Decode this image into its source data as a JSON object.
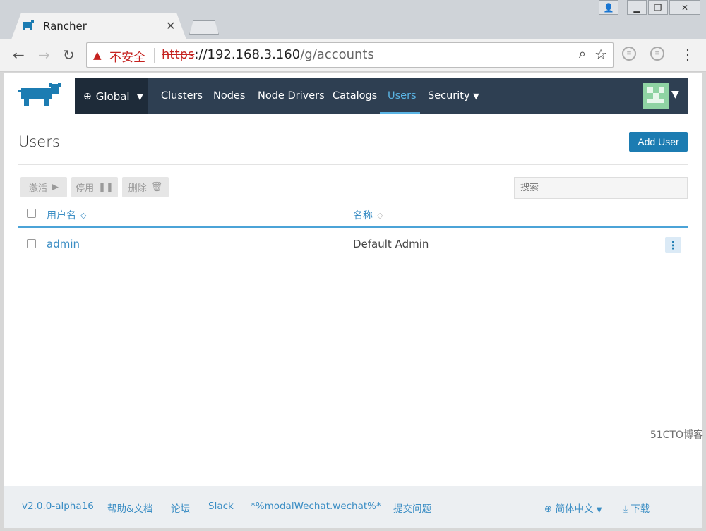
{
  "browser": {
    "tab_title": "Rancher",
    "insecure_label": "不安全",
    "url_scheme": "https",
    "url_host": "://192.168.3.160",
    "url_path": "/g/accounts"
  },
  "nav": {
    "global": "Global",
    "items": [
      "Clusters",
      "Nodes",
      "Node Drivers",
      "Catalogs",
      "Users",
      "Security"
    ]
  },
  "page": {
    "title": "Users",
    "add_button": "Add User"
  },
  "bulk_actions": {
    "activate": "激活",
    "deactivate": "停用",
    "delete": "删除"
  },
  "search": {
    "placeholder": "搜索"
  },
  "table": {
    "columns": [
      "用户名",
      "名称"
    ],
    "rows": [
      {
        "username": "admin",
        "name": "Default Admin"
      }
    ]
  },
  "footer": {
    "version": "v2.0.0-alpha16",
    "help": "帮助&文档",
    "forum": "论坛",
    "slack": "Slack",
    "wechat": "*%modalWechat.wechat%*",
    "issue": "提交问题",
    "language": "简体中文",
    "download": "下载"
  },
  "watermark": "51CTO博客"
}
